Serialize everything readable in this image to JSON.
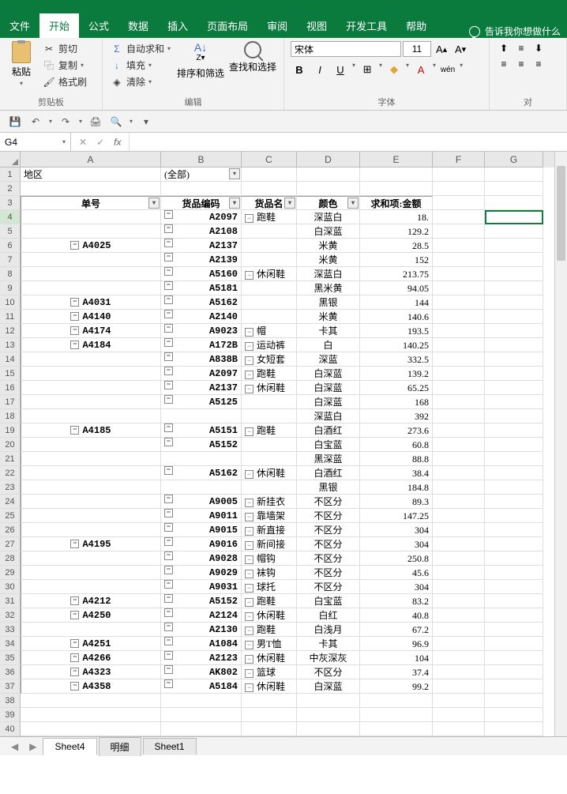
{
  "tabs": {
    "file": "文件",
    "home": "开始",
    "formula": "公式",
    "data": "数据",
    "insert": "插入",
    "layout": "页面布局",
    "review": "审阅",
    "view": "视图",
    "dev": "开发工具",
    "help": "帮助",
    "tellme": "告诉我你想做什么"
  },
  "ribbon": {
    "clipboard": {
      "label": "剪贴板",
      "paste": "粘贴",
      "cut": "剪切",
      "copy": "复制",
      "format": "格式刷"
    },
    "edit": {
      "label": "编辑",
      "autosum": "自动求和",
      "fill": "填充",
      "clear": "清除",
      "sort": "排序和筛选",
      "find": "查找和选择"
    },
    "font": {
      "label": "字体",
      "name": "宋体",
      "size": "11"
    },
    "align": {
      "label": "对"
    }
  },
  "namebox": "G4",
  "cols": [
    "A",
    "B",
    "C",
    "D",
    "E",
    "F",
    "G"
  ],
  "filter": {
    "region": "地区",
    "all": "(全部)"
  },
  "headers": {
    "order": "单号",
    "code": "货品编码",
    "name": "货品名",
    "color": "颜色",
    "amount": "求和项:金额"
  },
  "sheets": {
    "s1": "Sheet4",
    "s2": "明细",
    "s3": "Sheet1"
  },
  "rows": [
    {
      "n": 4,
      "o": "",
      "c": "A2097",
      "na": "跑鞋",
      "ea": true,
      "co": "深蓝白",
      "a": "18."
    },
    {
      "n": 5,
      "o": "",
      "c": "A2108",
      "na": "",
      "co": "白深蓝",
      "a": "129.2"
    },
    {
      "n": 6,
      "o": "A4025",
      "eo": true,
      "c": "A2137",
      "na": "",
      "co": "米黄",
      "a": "28.5"
    },
    {
      "n": 7,
      "o": "",
      "c": "A2139",
      "na": "",
      "co": "米黄",
      "a": "152"
    },
    {
      "n": 8,
      "o": "",
      "c": "A5160",
      "na": "休闲鞋",
      "ea": true,
      "co": "深蓝白",
      "a": "213.75"
    },
    {
      "n": 9,
      "o": "",
      "c": "A5181",
      "na": "",
      "co": "黑米黄",
      "a": "94.05"
    },
    {
      "n": 10,
      "o": "A4031",
      "eo": true,
      "c": "A5162",
      "na": "",
      "co": "黑银",
      "a": "144"
    },
    {
      "n": 11,
      "o": "A4140",
      "eo": true,
      "c": "A2140",
      "na": "",
      "co": "米黄",
      "a": "140.6"
    },
    {
      "n": 12,
      "o": "A4174",
      "eo": true,
      "c": "A9023",
      "na": "帽",
      "ea": true,
      "co": "卡其",
      "a": "193.5"
    },
    {
      "n": 13,
      "o": "A4184",
      "eo": true,
      "c": "A172B",
      "na": "运动裤",
      "ea": true,
      "co": "白",
      "a": "140.25"
    },
    {
      "n": 14,
      "o": "",
      "c": "A838B",
      "na": "女短套",
      "ea": true,
      "co": "深蓝",
      "a": "332.5"
    },
    {
      "n": 15,
      "o": "",
      "c": "A2097",
      "na": "跑鞋",
      "ea": true,
      "co": "白深蓝",
      "a": "139.2"
    },
    {
      "n": 16,
      "o": "",
      "c": "A2137",
      "na": "休闲鞋",
      "ea": true,
      "co": "白深蓝",
      "a": "65.25"
    },
    {
      "n": 17,
      "o": "",
      "c": "A5125",
      "ec": true,
      "na": "",
      "co": "白深蓝",
      "a": "168"
    },
    {
      "n": 18,
      "o": "",
      "c": "",
      "na": "",
      "co": "深蓝白",
      "a": "392"
    },
    {
      "n": 19,
      "o": "A4185",
      "eo": true,
      "c": "A5151",
      "na": "跑鞋",
      "ea": true,
      "co": "白酒红",
      "a": "273.6"
    },
    {
      "n": 20,
      "o": "",
      "c": "A5152",
      "ec": true,
      "na": "",
      "co": "白宝蓝",
      "a": "60.8"
    },
    {
      "n": 21,
      "o": "",
      "c": "",
      "na": "",
      "co": "黑深蓝",
      "a": "88.8"
    },
    {
      "n": 22,
      "o": "",
      "c": "A5162",
      "na": "休闲鞋",
      "ea": true,
      "co": "白酒红",
      "a": "38.4"
    },
    {
      "n": 23,
      "o": "",
      "c": "",
      "na": "",
      "co": "黑银",
      "a": "184.8"
    },
    {
      "n": 24,
      "o": "",
      "c": "A9005",
      "na": "新挂衣",
      "ea": true,
      "co": "不区分",
      "a": "89.3"
    },
    {
      "n": 25,
      "o": "",
      "c": "A9011",
      "na": "靠墙架",
      "ea": true,
      "co": "不区分",
      "a": "147.25"
    },
    {
      "n": 26,
      "o": "",
      "c": "A9015",
      "na": "新直接",
      "ea": true,
      "co": "不区分",
      "a": "304"
    },
    {
      "n": 27,
      "o": "A4195",
      "eo": true,
      "c": "A9016",
      "na": "新间接",
      "ea": true,
      "co": "不区分",
      "a": "304"
    },
    {
      "n": 28,
      "o": "",
      "c": "A9028",
      "na": "帽钩",
      "ea": true,
      "co": "不区分",
      "a": "250.8"
    },
    {
      "n": 29,
      "o": "",
      "c": "A9029",
      "na": "袜钩",
      "ea": true,
      "co": "不区分",
      "a": "45.6"
    },
    {
      "n": 30,
      "o": "",
      "c": "A9031",
      "na": "球托",
      "ea": true,
      "co": "不区分",
      "a": "304"
    },
    {
      "n": 31,
      "o": "A4212",
      "eo": true,
      "c": "A5152",
      "na": "跑鞋",
      "ea": true,
      "co": "白宝蓝",
      "a": "83.2"
    },
    {
      "n": 32,
      "o": "A4250",
      "eo": true,
      "c": "A2124",
      "na": "休闲鞋",
      "ea": true,
      "co": "白红",
      "a": "40.8"
    },
    {
      "n": 33,
      "o": "",
      "c": "A2130",
      "na": "跑鞋",
      "ea": true,
      "co": "白浅月",
      "a": "67.2"
    },
    {
      "n": 34,
      "o": "A4251",
      "eo": true,
      "c": "A1084",
      "na": "男T恤",
      "ea": true,
      "co": "卡其",
      "a": "96.9"
    },
    {
      "n": 35,
      "o": "A4266",
      "eo": true,
      "c": "A2123",
      "na": "休闲鞋",
      "ea": true,
      "co": "中灰深灰",
      "a": "104"
    },
    {
      "n": 36,
      "o": "A4323",
      "eo": true,
      "c": "AK802",
      "na": "篮球",
      "ea": true,
      "co": "不区分",
      "a": "37.4"
    },
    {
      "n": 37,
      "o": "A4358",
      "eo": true,
      "c": "A5184",
      "na": "休闲鞋",
      "ea": true,
      "co": "白深蓝",
      "a": "99.2"
    }
  ]
}
